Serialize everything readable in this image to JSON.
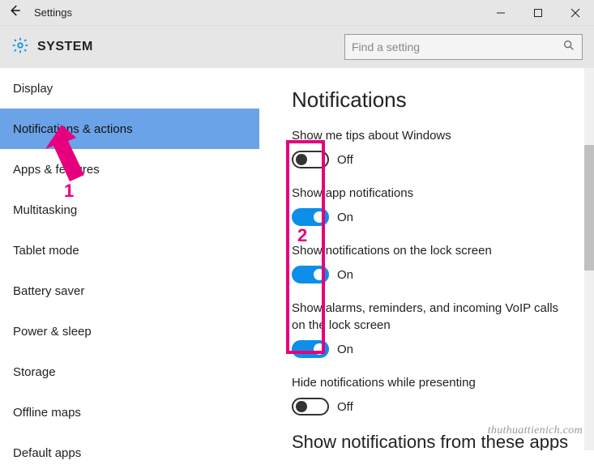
{
  "titlebar": {
    "title": "Settings"
  },
  "header": {
    "category": "SYSTEM",
    "search_placeholder": "Find a setting"
  },
  "sidebar": {
    "items": [
      {
        "label": "Display",
        "selected": false
      },
      {
        "label": "Notifications & actions",
        "selected": true
      },
      {
        "label": "Apps & features",
        "selected": false
      },
      {
        "label": "Multitasking",
        "selected": false
      },
      {
        "label": "Tablet mode",
        "selected": false
      },
      {
        "label": "Battery saver",
        "selected": false
      },
      {
        "label": "Power & sleep",
        "selected": false
      },
      {
        "label": "Storage",
        "selected": false
      },
      {
        "label": "Offline maps",
        "selected": false
      },
      {
        "label": "Default apps",
        "selected": false
      }
    ]
  },
  "content": {
    "page_title": "Notifications",
    "settings": [
      {
        "label": "Show me tips about Windows",
        "on": false,
        "state": "Off"
      },
      {
        "label": "Show app notifications",
        "on": true,
        "state": "On"
      },
      {
        "label": "Show notifications on the lock screen",
        "on": true,
        "state": "On"
      },
      {
        "label": "Show alarms, reminders, and incoming VoIP calls on the lock screen",
        "on": true,
        "state": "On"
      },
      {
        "label": "Hide notifications while presenting",
        "on": false,
        "state": "Off"
      }
    ],
    "cutoff_heading": "Show notifications from these apps"
  },
  "annotations": {
    "label1": "1",
    "label2": "2"
  },
  "watermark": "thuthuattienich.com"
}
